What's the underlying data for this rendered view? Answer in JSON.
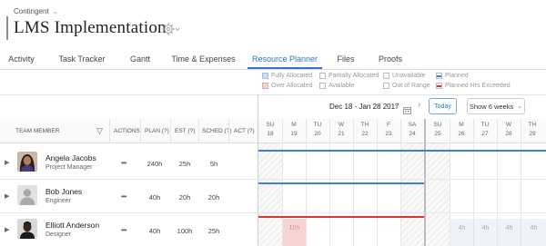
{
  "breadcrumb": {
    "label": "Contingent"
  },
  "page": {
    "title": "LMS Implementation"
  },
  "tabs": [
    {
      "label": "Activity"
    },
    {
      "label": "Task Tracker"
    },
    {
      "label": "Gantt"
    },
    {
      "label": "Time & Expenses"
    },
    {
      "label": "Resource Planner",
      "active": true
    },
    {
      "label": "Files"
    },
    {
      "label": "Proofs"
    }
  ],
  "legend": {
    "fully_allocated": "Fully Allocated",
    "partially_allocated": "Partially Allocated",
    "unavailable": "Unavailable",
    "planned": "Planned",
    "over_allocated": "Over Allocated",
    "available": "Available",
    "out_of_range": "Out of Range",
    "planned_hrs_exceeded": "Planned Hrs Exceeded"
  },
  "nav": {
    "date_range": "Dec 18 - Jan 28 2017",
    "today_label": "Today",
    "weeks_label": "Show 6 weeks",
    "prev": "‹",
    "next": "›"
  },
  "columns": {
    "team_member": "TEAM MEMBER",
    "actions": "ACTIONS",
    "plan": "PLAN (?)",
    "est": "EST (?)",
    "sched": "SCHED (?)",
    "act": "ACT (?)"
  },
  "days": [
    {
      "dow": "SU",
      "date": "18"
    },
    {
      "dow": "M",
      "date": "19"
    },
    {
      "dow": "TU",
      "date": "20"
    },
    {
      "dow": "W",
      "date": "21"
    },
    {
      "dow": "TH",
      "date": "22"
    },
    {
      "dow": "F",
      "date": "23"
    },
    {
      "dow": "SA",
      "date": "24"
    },
    {
      "dow": "SU",
      "date": "25"
    },
    {
      "dow": "M",
      "date": "26"
    },
    {
      "dow": "TU",
      "date": "27"
    },
    {
      "dow": "W",
      "date": "28"
    },
    {
      "dow": "TH",
      "date": "29"
    }
  ],
  "members": [
    {
      "name": "Angela Jacobs",
      "role": "Project Manager",
      "actions": "•••",
      "plan": "240h",
      "est": "25h",
      "sched": "5h",
      "act": ""
    },
    {
      "name": "Bob Jones",
      "role": "Engineer",
      "actions": "•••",
      "plan": "40h",
      "est": "20h",
      "sched": "20h",
      "act": ""
    },
    {
      "name": "Elliott Anderson",
      "role": "Designer",
      "actions": "•••",
      "plan": "40h",
      "est": "100h",
      "sched": "25h",
      "act": ""
    }
  ],
  "allocations": {
    "elliott_over": "10h",
    "elliott_avail": [
      "4h",
      "4h",
      "4h",
      "4h"
    ]
  },
  "colors": {
    "accent": "#2d76c7",
    "planned": "#3b7fd6",
    "planned_exceeded": "#d33a36",
    "over_allocated": "#f6d4d1",
    "fully_allocated": "#cfdff0"
  }
}
